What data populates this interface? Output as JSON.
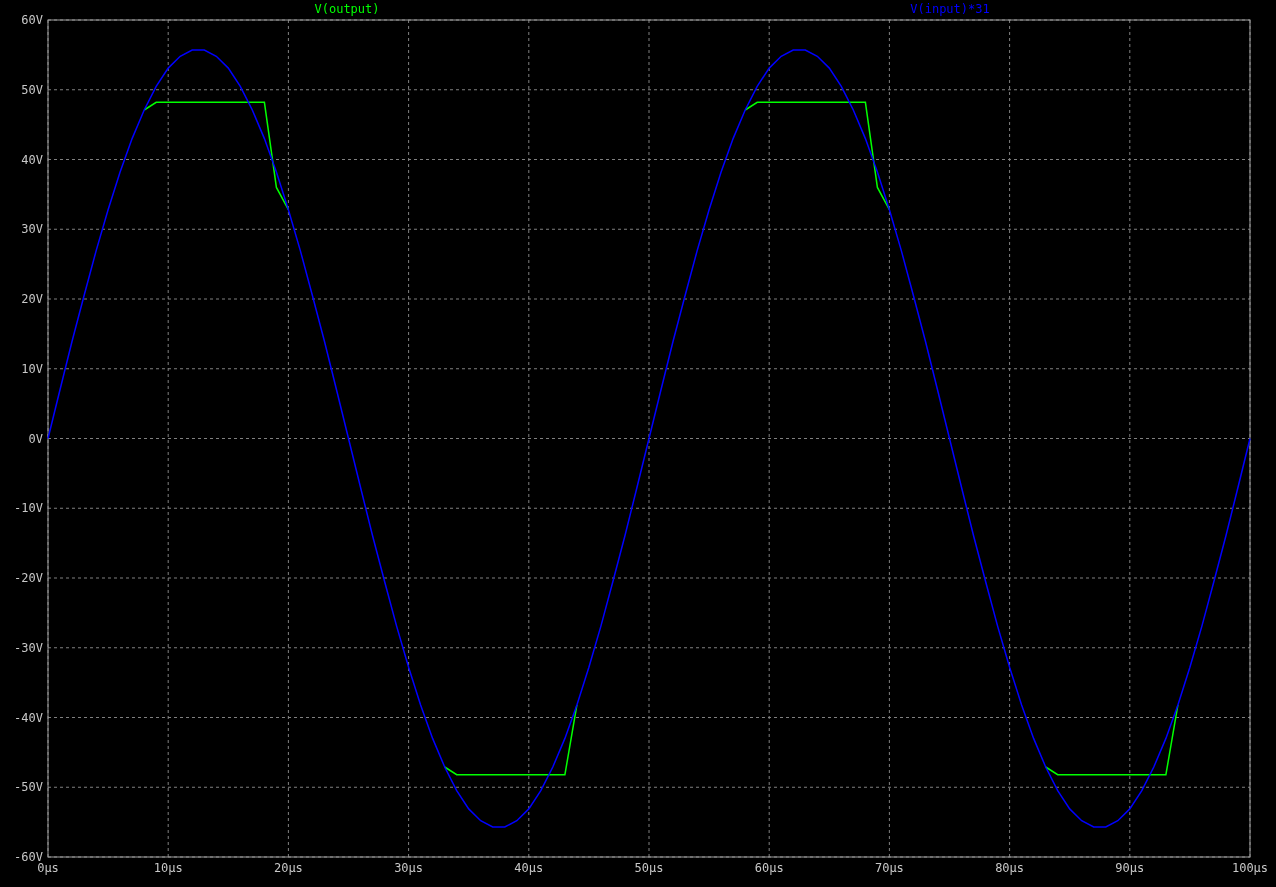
{
  "plot": {
    "chart_data": {
      "type": "line",
      "grid": true,
      "xlim": [
        0,
        100
      ],
      "ylim": [
        -60,
        60
      ],
      "x": [
        0,
        1,
        2,
        3,
        4,
        5,
        6,
        7,
        8,
        9,
        10,
        11,
        12,
        13,
        14,
        15,
        16,
        17,
        18,
        19,
        20,
        21,
        22,
        23,
        24,
        25,
        26,
        27,
        28,
        29,
        30,
        31,
        32,
        33,
        34,
        35,
        36,
        37,
        38,
        39,
        40,
        41,
        42,
        43,
        44,
        45,
        46,
        47,
        48,
        49,
        50,
        51,
        52,
        53,
        54,
        55,
        56,
        57,
        58,
        59,
        60,
        61,
        62,
        63,
        64,
        65,
        66,
        67,
        68,
        69,
        70,
        71,
        72,
        73,
        74,
        75,
        76,
        77,
        78,
        79,
        80,
        81,
        82,
        83,
        84,
        85,
        86,
        87,
        88,
        89,
        90,
        91,
        92,
        93,
        94,
        95,
        96,
        97,
        98,
        99,
        100
      ],
      "series": [
        {
          "name": "V(output)",
          "color": "#00ff00",
          "values": [
            null,
            null,
            null,
            null,
            null,
            null,
            null,
            null,
            47.1,
            48.2,
            48.2,
            48.2,
            48.2,
            48.2,
            48.2,
            48.2,
            48.2,
            48.2,
            48.2,
            36,
            32.8,
            null,
            null,
            null,
            null,
            null,
            null,
            null,
            null,
            null,
            null,
            null,
            null,
            -47.1,
            -48.2,
            -48.2,
            -48.2,
            -48.2,
            -48.2,
            -48.2,
            -48.2,
            -48.2,
            -48.2,
            -48.2,
            -38.2,
            null,
            null,
            null,
            null,
            null,
            null,
            null,
            null,
            null,
            null,
            null,
            null,
            null,
            47.1,
            48.2,
            48.2,
            48.2,
            48.2,
            48.2,
            48.2,
            48.2,
            48.2,
            48.2,
            48.2,
            36,
            32.8,
            null,
            null,
            null,
            null,
            null,
            null,
            null,
            null,
            null,
            null,
            null,
            null,
            -47.1,
            -48.2,
            -48.2,
            -48.2,
            -48.2,
            -48.2,
            -48.2,
            -48.2,
            -48.2,
            -48.2,
            -48.2,
            -38.2,
            null,
            null,
            null,
            null,
            null,
            null
          ]
        },
        {
          "name": "V(input)*31",
          "color": "#0000ff",
          "values": [
            0,
            7,
            13.9,
            20.5,
            26.9,
            32.8,
            38.2,
            43,
            47.1,
            50.5,
            53.1,
            54.8,
            55.7,
            55.7,
            54.8,
            53.1,
            50.5,
            47.1,
            43,
            38.2,
            32.8,
            26.9,
            20.5,
            13.9,
            7,
            0,
            -7,
            -13.9,
            -20.5,
            -26.9,
            -32.8,
            -38.2,
            -43,
            -47.1,
            -50.5,
            -53.1,
            -54.8,
            -55.7,
            -55.7,
            -54.8,
            -53.1,
            -50.5,
            -47.1,
            -43,
            -38.2,
            -32.8,
            -26.9,
            -20.5,
            -13.9,
            -7,
            0,
            7,
            13.9,
            20.5,
            26.9,
            32.8,
            38.2,
            43,
            47.1,
            50.5,
            53.1,
            54.8,
            55.7,
            55.7,
            54.8,
            53.1,
            50.5,
            47.1,
            43,
            38.2,
            32.8,
            26.9,
            20.5,
            13.9,
            7,
            0,
            -7,
            -13.9,
            -20.5,
            -26.9,
            -32.8,
            -38.2,
            -43,
            -47.1,
            -50.5,
            -53.1,
            -54.8,
            -55.7,
            -55.7,
            -54.8,
            -53.1,
            -50.5,
            -47.1,
            -43,
            -38.2,
            -32.8,
            -26.9,
            -20.5,
            -13.9,
            -7,
            0
          ]
        }
      ],
      "xticks": [
        {
          "value": 0,
          "label": "0µs"
        },
        {
          "value": 10,
          "label": "10µs"
        },
        {
          "value": 20,
          "label": "20µs"
        },
        {
          "value": 30,
          "label": "30µs"
        },
        {
          "value": 40,
          "label": "40µs"
        },
        {
          "value": 50,
          "label": "50µs"
        },
        {
          "value": 60,
          "label": "60µs"
        },
        {
          "value": 70,
          "label": "70µs"
        },
        {
          "value": 80,
          "label": "80µs"
        },
        {
          "value": 90,
          "label": "90µs"
        },
        {
          "value": 100,
          "label": "100µs"
        }
      ],
      "yticks": [
        {
          "value": 60,
          "label": "60V"
        },
        {
          "value": 50,
          "label": "50V"
        },
        {
          "value": 40,
          "label": "40V"
        },
        {
          "value": 30,
          "label": "30V"
        },
        {
          "value": 20,
          "label": "20V"
        },
        {
          "value": 10,
          "label": "10V"
        },
        {
          "value": 0,
          "label": "0V"
        },
        {
          "value": -10,
          "label": "-10V"
        },
        {
          "value": -20,
          "label": "-20V"
        },
        {
          "value": -30,
          "label": "-30V"
        },
        {
          "value": -40,
          "label": "-40V"
        },
        {
          "value": -50,
          "label": "-50V"
        },
        {
          "value": -60,
          "label": "-60V"
        }
      ]
    }
  }
}
